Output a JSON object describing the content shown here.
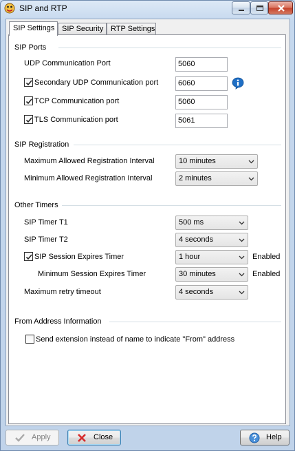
{
  "window": {
    "title": "SIP and RTP"
  },
  "tabs": [
    "SIP Settings",
    "SIP Security",
    "RTP Settings"
  ],
  "sip_ports": {
    "title": "SIP Ports",
    "udp_label": "UDP Communication Port",
    "udp_value": "5060",
    "secondary_udp_label": "Secondary UDP Communication port",
    "secondary_udp_value": "6060",
    "tcp_label": "TCP Communication port",
    "tcp_value": "5060",
    "tls_label": "TLS Communication port",
    "tls_value": "5061"
  },
  "sip_registration": {
    "title": "SIP Registration",
    "max_label": "Maximum Allowed Registration Interval",
    "max_value": "10 minutes",
    "min_label": "Minimum Allowed Registration Interval",
    "min_value": "2 minutes"
  },
  "other_timers": {
    "title": "Other Timers",
    "t1_label": "SIP Timer T1",
    "t1_value": "500 ms",
    "t2_label": "SIP Timer T2",
    "t2_value": "4 seconds",
    "session_expires_label": "SIP Session Expires Timer",
    "session_expires_value": "1 hour",
    "session_expires_status": "Enabled",
    "min_session_label": "Minimum Session Expires Timer",
    "min_session_value": "30 minutes",
    "min_session_status": "Enabled",
    "max_retry_label": "Maximum retry timeout",
    "max_retry_value": "4 seconds"
  },
  "from_address": {
    "title": "From Address Information",
    "send_extension_label": "Send extension instead of name to indicate \"From\" address"
  },
  "buttons": {
    "apply": "Apply",
    "close": "Close",
    "help": "Help"
  },
  "colors": {
    "titlebar": "#c5d8ee",
    "close_button": "#c4412a",
    "info_icon": "#1f6fc5",
    "close_icon": "#d62b2b"
  }
}
